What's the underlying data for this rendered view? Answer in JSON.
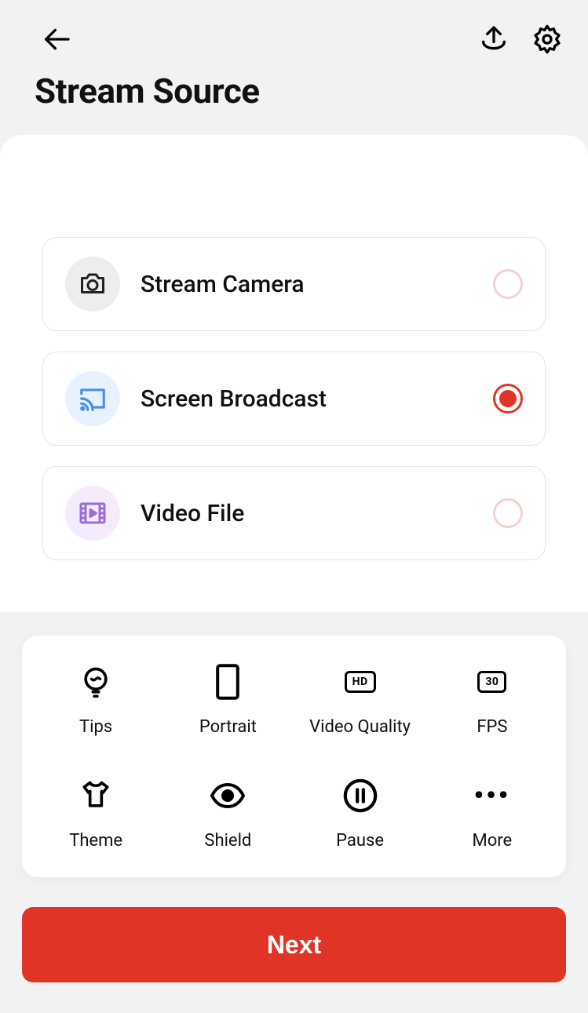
{
  "header": {
    "title": "Stream Source"
  },
  "options": [
    {
      "label": "Stream Camera",
      "selected": false
    },
    {
      "label": "Screen Broadcast",
      "selected": true
    },
    {
      "label": "Video File",
      "selected": false
    }
  ],
  "tools": [
    {
      "label": "Tips"
    },
    {
      "label": "Portrait"
    },
    {
      "label": "Video Quality",
      "badge": "HD"
    },
    {
      "label": "FPS",
      "badge": "30"
    },
    {
      "label": "Theme"
    },
    {
      "label": "Shield"
    },
    {
      "label": "Pause"
    },
    {
      "label": "More"
    }
  ],
  "footer": {
    "next_label": "Next"
  }
}
